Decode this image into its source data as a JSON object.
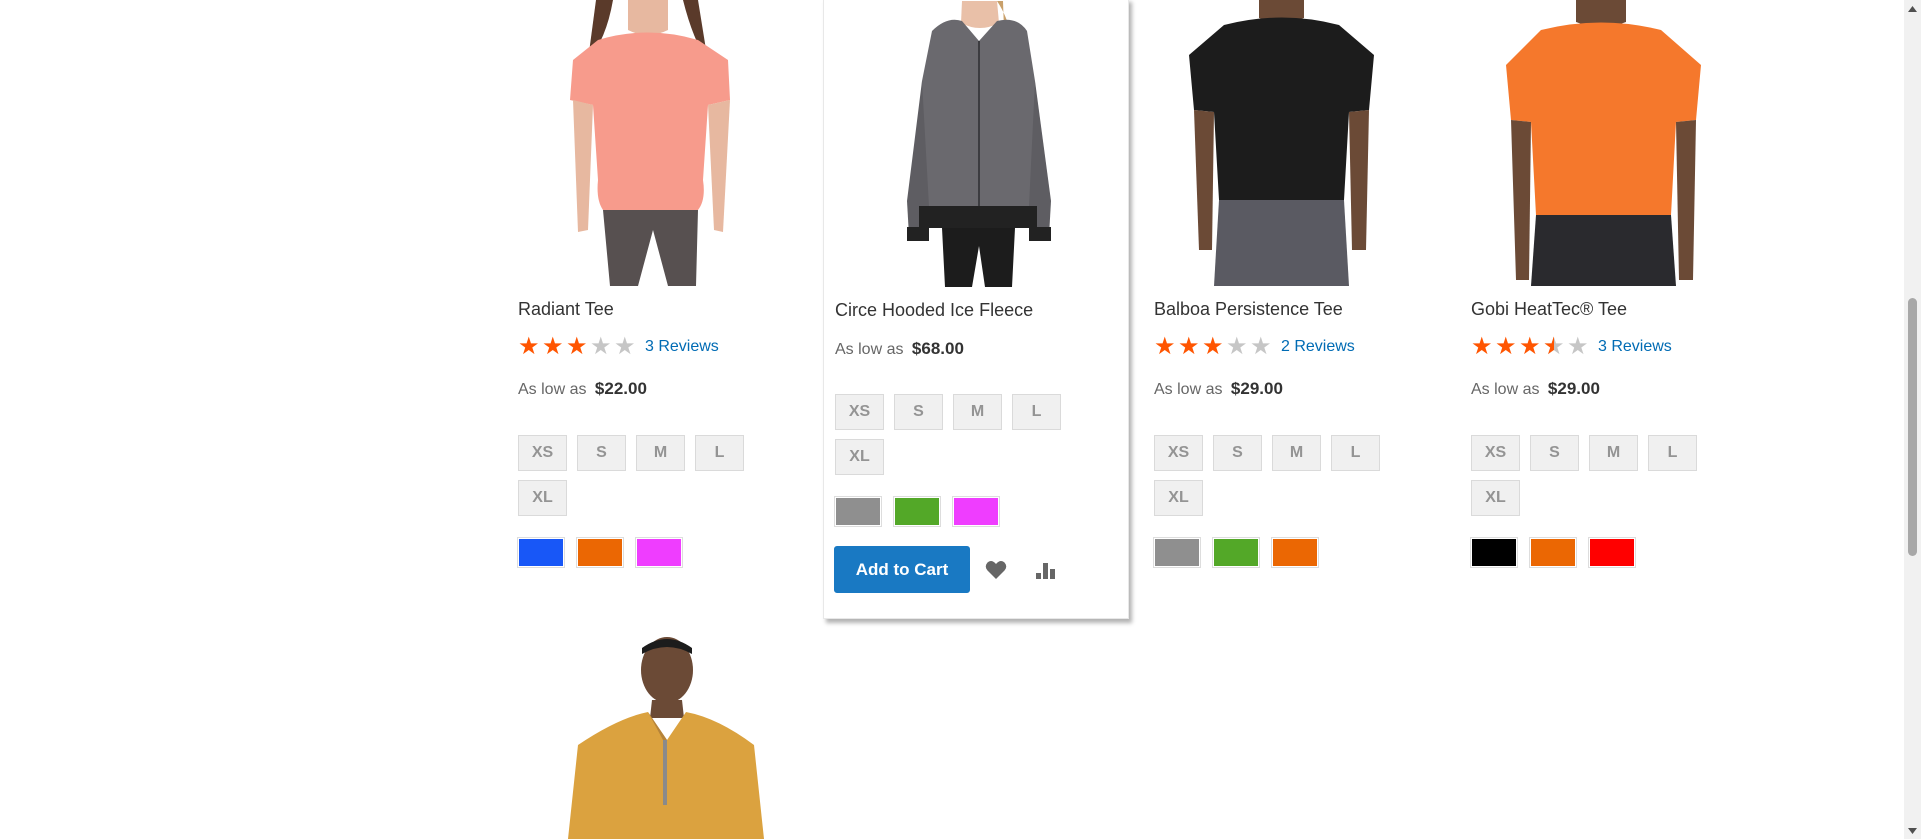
{
  "products": [
    {
      "name": "Radiant Tee",
      "rating": 3,
      "reviews": "3 Reviews",
      "price_prefix": "As low as",
      "price": "$22.00",
      "sizes": [
        "XS",
        "S",
        "M",
        "L",
        "XL"
      ],
      "colors": [
        "#1857f7",
        "#eb6703",
        "#ef3dff"
      ]
    },
    {
      "name": "Circe Hooded Ice Fleece",
      "price_prefix": "As low as",
      "price": "$68.00",
      "sizes": [
        "XS",
        "S",
        "M",
        "L",
        "XL"
      ],
      "colors": [
        "#8f8f8f",
        "#53a828",
        "#ef3dff"
      ],
      "add_to_cart": "Add to Cart"
    },
    {
      "name": "Balboa Persistence Tee",
      "rating": 3,
      "reviews": "2 Reviews",
      "price_prefix": "As low as",
      "price": "$29.00",
      "sizes": [
        "XS",
        "S",
        "M",
        "L",
        "XL"
      ],
      "colors": [
        "#8f8f8f",
        "#53a828",
        "#eb6703"
      ]
    },
    {
      "name": "Gobi HeatTec® Tee",
      "rating": 3.5,
      "reviews": "3 Reviews",
      "price_prefix": "As low as",
      "price": "$29.00",
      "sizes": [
        "XS",
        "S",
        "M",
        "L",
        "XL"
      ],
      "colors": [
        "#000000",
        "#eb6703",
        "#ff0000"
      ]
    }
  ],
  "icons": {
    "wishlist": "heart-icon",
    "compare": "compare-chart-icon"
  }
}
